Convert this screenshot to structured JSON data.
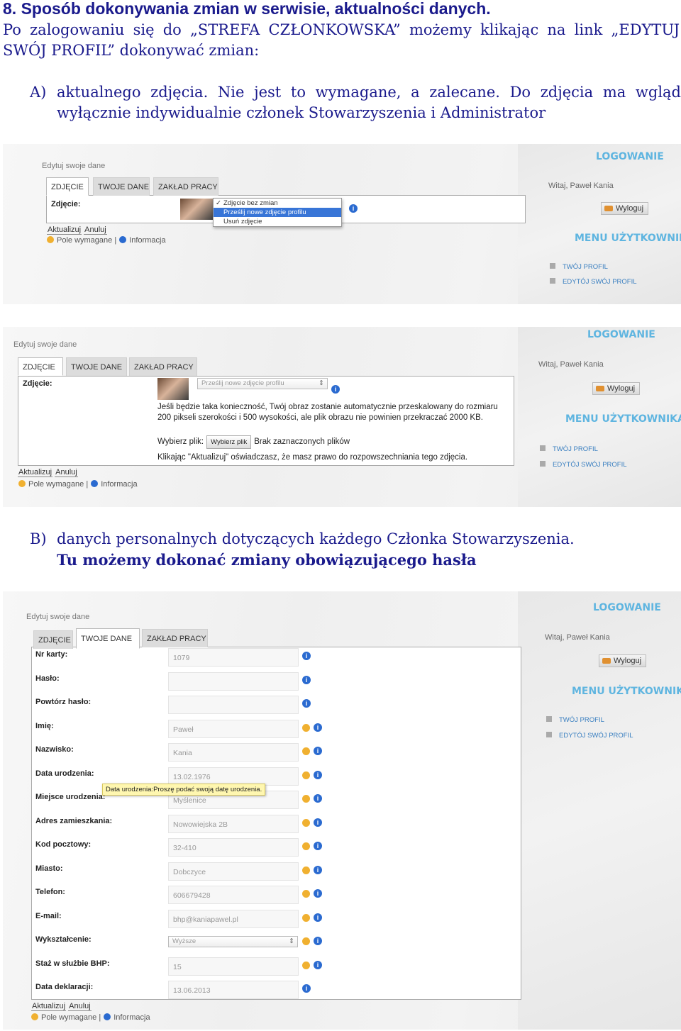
{
  "heading": "8. Sposób dokonywania zmian w serwisie, aktualności danych.",
  "intro": "Po zalogowaniu się do „STREFA CZŁONKOWSKA” możemy klikając na link „EDYTUJ SWÓJ PROFIL” dokonywać zmian:",
  "point_a": {
    "label": "A)",
    "text": "aktualnego zdjęcia. Nie jest to wymagane, a zalecane. Do zdjęcia ma wgląd wyłącznie indywidualnie członek Stowarzyszenia i Administrator"
  },
  "point_b": {
    "label": "B)",
    "line1": "danych personalnych dotyczących każdego Członka Stowarzyszenia.",
    "line2": "Tu możemy dokonać zmiany obowiązującego hasła"
  },
  "ui": {
    "edit_title": "Edytuj swoje dane",
    "tabs": [
      "ZDJĘCIE",
      "TWOJE DANE",
      "ZAKŁAD PRACY"
    ],
    "photo_label": "Zdjęcie:",
    "btn_update": "Aktualizuj",
    "btn_cancel": "Anuluj",
    "required": "Pole wymagane",
    "separator": "|",
    "info": "Informacja",
    "side": {
      "login_title": "LOGOWANIE",
      "greeting": "Witaj, Paweł Kania",
      "logout": "Wyloguj",
      "menu_title": "MENU UŻYTKOWNIKA",
      "links": [
        "TWÓJ PROFIL",
        "EDYTÓJ SWÓJ PROFIL"
      ]
    }
  },
  "shot1": {
    "dropdown": [
      "Zdjęcie bez zmian",
      "Prześlij nowe zdjęcie profilu",
      "Usuń zdjęcie"
    ],
    "check": "✓"
  },
  "shot2": {
    "select_value": "Prześlij nowe zdjęcie profilu",
    "note": "Jeśli będzie taka konieczność, Twój obraz zostanie automatycznie przeskalowany do rozmiaru 200 pikseli szerokości i 500 wysokości, ale plik obrazu nie powinien przekraczać 2000 KB.",
    "choose_label": "Wybierz plik:",
    "choose_button": "Wybierz plik",
    "no_file": "Brak zaznaczonych plików",
    "consent": "Klikając \"Aktualizuj\" oświadczasz, że masz prawo do rozpowszechniania tego zdjęcia."
  },
  "shot3": {
    "fields": [
      {
        "label": "Nr karty:",
        "value": "1079"
      },
      {
        "label": "Hasło:",
        "value": ""
      },
      {
        "label": "Powtórz hasło:",
        "value": ""
      },
      {
        "label": "Imię:",
        "value": "Paweł"
      },
      {
        "label": "Nazwisko:",
        "value": "Kania"
      },
      {
        "label": "Data urodzenia:",
        "value": "13.02.1976"
      },
      {
        "label": "Miejsce urodzenia:",
        "value": "Myślenice"
      },
      {
        "label": "Adres zamieszkania:",
        "value": "Nowowiejska 2B"
      },
      {
        "label": "Kod pocztowy:",
        "value": "32-410"
      },
      {
        "label": "Miasto:",
        "value": "Dobczyce"
      },
      {
        "label": "Telefon:",
        "value": "606679428"
      },
      {
        "label": "E-mail:",
        "value": "bhp@kaniapawel.pl"
      },
      {
        "label": "Wykształcenie:",
        "value": "Wyższe"
      },
      {
        "label": "Staż w służbie BHP:",
        "value": "15"
      },
      {
        "label": "Data deklaracji:",
        "value": "13.06.2013"
      }
    ],
    "tooltip": "Data urodzenia:Proszę podać swoją datę urodzenia."
  }
}
